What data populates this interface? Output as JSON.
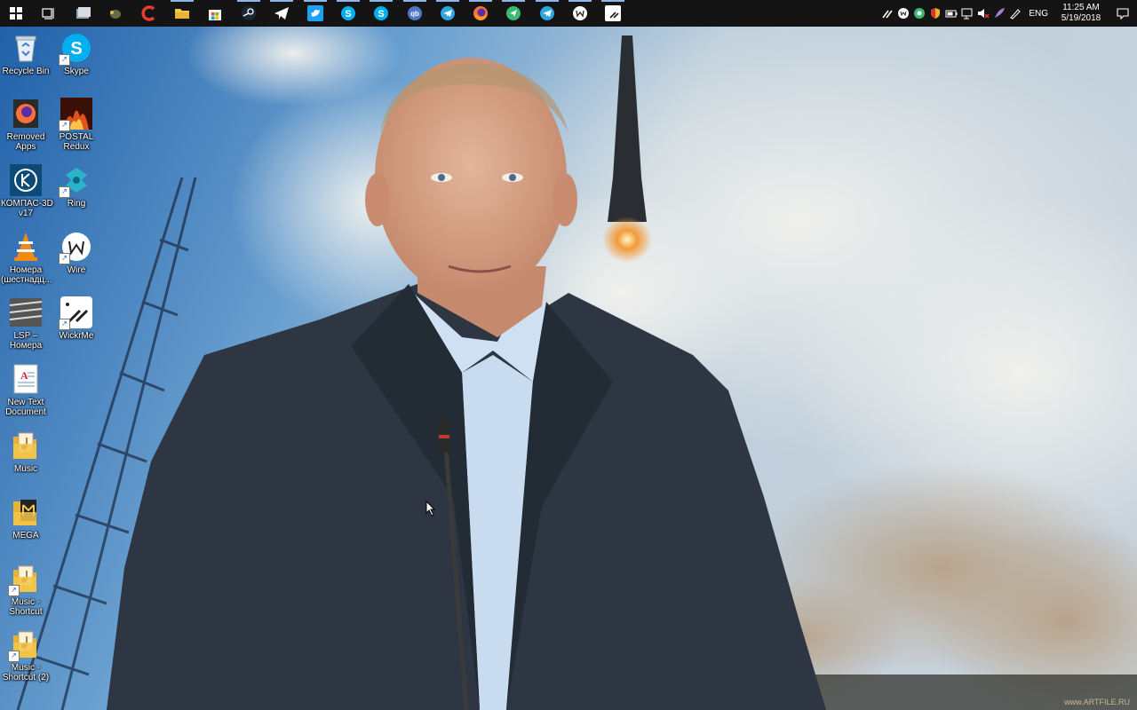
{
  "taskbar": {
    "pinned": [
      {
        "name": "start-button",
        "icon": "windows-logo-icon"
      },
      {
        "name": "task-view-button",
        "icon": "task-view-icon"
      },
      {
        "name": "taskbar-app-1",
        "icon": "window-app-icon"
      },
      {
        "name": "taskbar-app-2",
        "icon": "bug-app-icon"
      },
      {
        "name": "taskbar-app-ccleaner",
        "icon": "ccleaner-icon"
      },
      {
        "name": "taskbar-app-explorer",
        "icon": "folder-icon"
      },
      {
        "name": "taskbar-app-store",
        "icon": "store-icon"
      },
      {
        "name": "taskbar-app-steam",
        "icon": "steam-icon"
      },
      {
        "name": "taskbar-app-telegram",
        "icon": "telegram-icon"
      },
      {
        "name": "taskbar-app-twitter",
        "icon": "twitter-icon"
      },
      {
        "name": "taskbar-app-skype",
        "icon": "skype-icon"
      },
      {
        "name": "taskbar-app-skype-2",
        "icon": "skype-icon"
      },
      {
        "name": "taskbar-app-qbittorrent",
        "icon": "qbittorrent-icon"
      },
      {
        "name": "taskbar-app-telegram-2",
        "icon": "telegram-icon"
      },
      {
        "name": "taskbar-app-firefox",
        "icon": "firefox-icon"
      },
      {
        "name": "taskbar-app-messenger",
        "icon": "green-send-icon"
      },
      {
        "name": "taskbar-app-telegram-3",
        "icon": "telegram-icon"
      },
      {
        "name": "taskbar-app-wire",
        "icon": "wire-icon"
      },
      {
        "name": "taskbar-app-wickrme",
        "icon": "wickrme-icon"
      }
    ],
    "tray": {
      "language": "ENG",
      "time": "11:25 AM",
      "date": "5/19/2018"
    }
  },
  "desktop": {
    "icons": [
      {
        "label": "Recycle Bin",
        "icon": "recycle-bin-icon"
      },
      {
        "label": "Skype",
        "icon": "skype-icon"
      },
      {
        "label": "Removed Apps",
        "icon": "firefox-icon"
      },
      {
        "label": "POSTAL Redux",
        "icon": "postal-redux-icon"
      },
      {
        "label": "КОМПАС-3D v17",
        "icon": "kompas-icon"
      },
      {
        "label": "Ring",
        "icon": "ring-icon"
      },
      {
        "label": "Номера (шестнадц...",
        "icon": "vlc-icon"
      },
      {
        "label": "Wire",
        "icon": "wire-icon"
      },
      {
        "label": "LSP – Номера",
        "icon": "lsp-icon"
      },
      {
        "label": "WickrMe",
        "icon": "wickrme-icon"
      },
      {
        "label": "New Text Document",
        "icon": "text-document-icon"
      },
      {
        "label": "Music",
        "icon": "music-folder-icon"
      },
      {
        "label": "MEGA",
        "icon": "mega-folder-icon"
      },
      {
        "label": "Music - Shortcut",
        "icon": "music-folder-icon"
      },
      {
        "label": "Music - Shortcut (2)",
        "icon": "music-folder-icon"
      }
    ]
  },
  "watermark": "www.ARTFILE.RU"
}
